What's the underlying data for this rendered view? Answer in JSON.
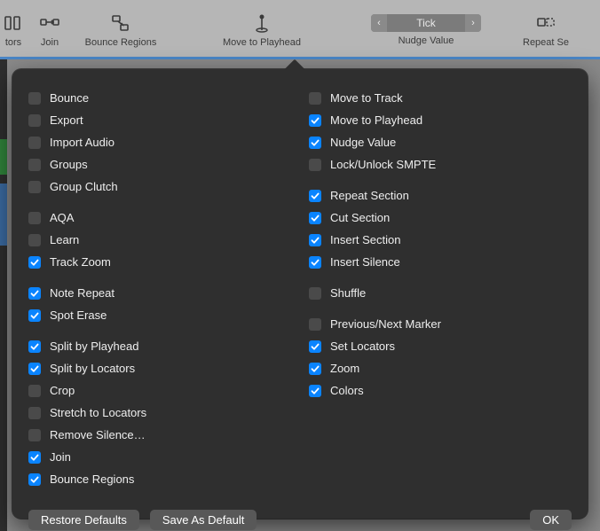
{
  "toolbar": {
    "items": [
      {
        "name": "tors",
        "label": "tors"
      },
      {
        "name": "join",
        "label": "Join"
      },
      {
        "name": "bounce-regions",
        "label": "Bounce Regions"
      },
      {
        "name": "move-to-playhead",
        "label": "Move to Playhead"
      },
      {
        "name": "nudge-value",
        "label": "Nudge Value"
      },
      {
        "name": "repeat-section",
        "label": "Repeat Se"
      }
    ],
    "nudge": {
      "prev": "‹",
      "value": "Tick",
      "next": "›"
    }
  },
  "options": {
    "left": [
      [
        {
          "key": "bounce",
          "label": "Bounce",
          "checked": false
        },
        {
          "key": "export",
          "label": "Export",
          "checked": false
        },
        {
          "key": "import-audio",
          "label": "Import Audio",
          "checked": false
        },
        {
          "key": "groups",
          "label": "Groups",
          "checked": false
        },
        {
          "key": "group-clutch",
          "label": "Group Clutch",
          "checked": false
        }
      ],
      [
        {
          "key": "aqa",
          "label": "AQA",
          "checked": false
        },
        {
          "key": "learn",
          "label": "Learn",
          "checked": false
        },
        {
          "key": "track-zoom",
          "label": "Track Zoom",
          "checked": true
        }
      ],
      [
        {
          "key": "note-repeat",
          "label": "Note Repeat",
          "checked": true
        },
        {
          "key": "spot-erase",
          "label": "Spot Erase",
          "checked": true
        }
      ],
      [
        {
          "key": "split-by-playhead",
          "label": "Split by Playhead",
          "checked": true
        },
        {
          "key": "split-by-locators",
          "label": "Split by Locators",
          "checked": true
        },
        {
          "key": "crop",
          "label": "Crop",
          "checked": false
        },
        {
          "key": "stretch-to-locators",
          "label": "Stretch to Locators",
          "checked": false
        },
        {
          "key": "remove-silence",
          "label": "Remove Silence…",
          "checked": false
        },
        {
          "key": "join-opt",
          "label": "Join",
          "checked": true
        },
        {
          "key": "bounce-regions-opt",
          "label": "Bounce Regions",
          "checked": true
        }
      ]
    ],
    "right": [
      [
        {
          "key": "move-to-track",
          "label": "Move to Track",
          "checked": false
        },
        {
          "key": "move-to-playhead-opt",
          "label": "Move to Playhead",
          "checked": true
        },
        {
          "key": "nudge-value-opt",
          "label": "Nudge Value",
          "checked": true
        },
        {
          "key": "lock-unlock-smpte",
          "label": "Lock/Unlock SMPTE",
          "checked": false
        }
      ],
      [
        {
          "key": "repeat-section-opt",
          "label": "Repeat Section",
          "checked": true
        },
        {
          "key": "cut-section",
          "label": "Cut Section",
          "checked": true
        },
        {
          "key": "insert-section",
          "label": "Insert Section",
          "checked": true
        },
        {
          "key": "insert-silence",
          "label": "Insert Silence",
          "checked": true
        }
      ],
      [
        {
          "key": "shuffle",
          "label": "Shuffle",
          "checked": false
        }
      ],
      [
        {
          "key": "prev-next-marker",
          "label": "Previous/Next Marker",
          "checked": false
        },
        {
          "key": "set-locators",
          "label": "Set Locators",
          "checked": true
        },
        {
          "key": "zoom",
          "label": "Zoom",
          "checked": true
        },
        {
          "key": "colors",
          "label": "Colors",
          "checked": true
        }
      ]
    ]
  },
  "footer": {
    "restore": "Restore Defaults",
    "save": "Save As Default",
    "ok": "OK"
  }
}
